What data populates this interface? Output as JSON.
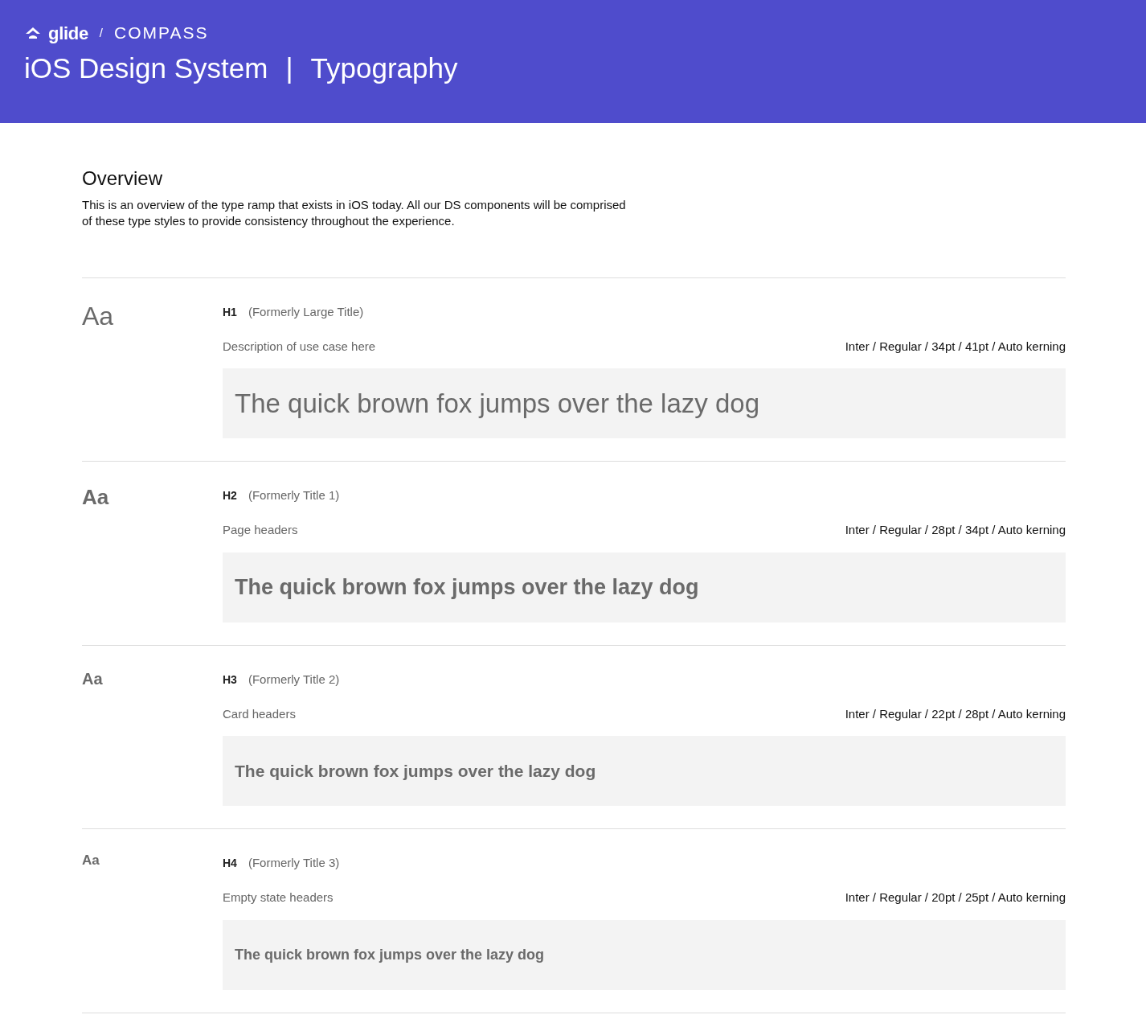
{
  "header": {
    "brand": "glide",
    "separator": "/",
    "partner": "COMPASS",
    "title": "iOS Design System",
    "divider": "|",
    "subtitle": "Typography"
  },
  "overview": {
    "heading": "Overview",
    "text": "This is an overview of the type ramp that exists in iOS today. All our DS components will be comprised of these type styles to provide consistency throughout the experience."
  },
  "styles": [
    {
      "kind": "h1",
      "glyph": "Aa",
      "name": "H1",
      "former": "(Formerly Large Title)",
      "description": "Description of use case here",
      "spec": "Inter / Regular / 34pt / 41pt / Auto kerning",
      "sample": "The quick brown fox jumps over the lazy dog"
    },
    {
      "kind": "h2",
      "glyph": "Aa",
      "name": "H2",
      "former": "(Formerly Title 1)",
      "description": "Page headers",
      "spec": "Inter / Regular / 28pt / 34pt / Auto kerning",
      "sample": "The quick brown fox jumps over the lazy dog"
    },
    {
      "kind": "h3",
      "glyph": "Aa",
      "name": "H3",
      "former": "(Formerly Title 2)",
      "description": "Card headers",
      "spec": "Inter / Regular / 22pt / 28pt / Auto kerning",
      "sample": "The quick brown fox jumps over the lazy dog"
    },
    {
      "kind": "h4",
      "glyph": "Aa",
      "name": "H4",
      "former": "(Formerly Title 3)",
      "description": "Empty state headers",
      "spec": "Inter / Regular / 20pt / 25pt / Auto kerning",
      "sample": "The quick brown fox jumps over the lazy dog"
    }
  ]
}
